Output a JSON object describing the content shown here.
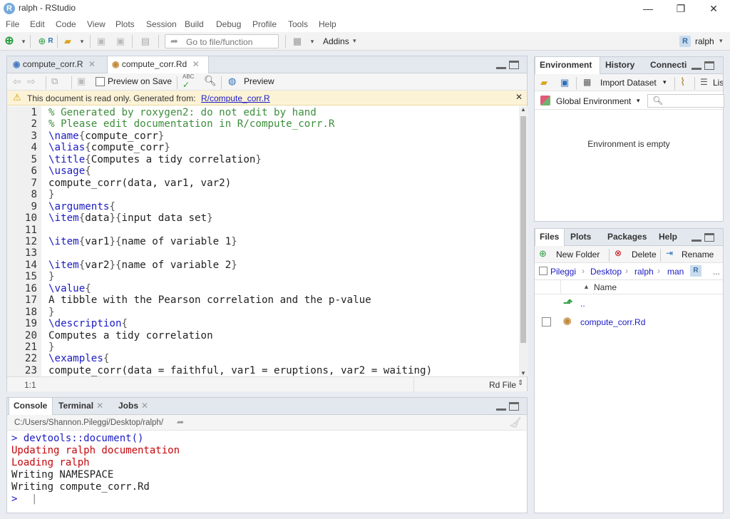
{
  "window": {
    "title": "ralph - RStudio",
    "app_icon": "R",
    "minimize": "—",
    "restore": "❐",
    "close": "✕"
  },
  "menu": [
    "File",
    "Edit",
    "Code",
    "View",
    "Plots",
    "Session",
    "Build",
    "Debug",
    "Profile",
    "Tools",
    "Help"
  ],
  "toolbar": {
    "goto_placeholder": "Go to file/function",
    "addins_label": "Addins",
    "project_label": "ralph"
  },
  "editor": {
    "tabs": [
      {
        "label": "compute_corr.R",
        "active": false
      },
      {
        "label": "compute_corr.Rd",
        "active": true
      }
    ],
    "preview_on_save_label": "Preview on Save",
    "preview_label": "Preview",
    "readonly_text": "This document is read only. Generated from:",
    "readonly_link": "R/compute_corr.R",
    "lines": [
      {
        "n": "1",
        "parts": [
          [
            "cm",
            "% Generated by roxygen2: do not edit by hand"
          ]
        ]
      },
      {
        "n": "2",
        "parts": [
          [
            "cm",
            "% Please edit documentation in R/compute_corr.R"
          ]
        ]
      },
      {
        "n": "3",
        "parts": [
          [
            "kw",
            "\\name"
          ],
          [
            "br",
            "{"
          ],
          [
            "tx",
            "compute_corr"
          ],
          [
            "br",
            "}"
          ]
        ]
      },
      {
        "n": "4",
        "parts": [
          [
            "kw",
            "\\alias"
          ],
          [
            "br",
            "{"
          ],
          [
            "tx",
            "compute_corr"
          ],
          [
            "br",
            "}"
          ]
        ]
      },
      {
        "n": "5",
        "parts": [
          [
            "kw",
            "\\title"
          ],
          [
            "br",
            "{"
          ],
          [
            "tx",
            "Computes a tidy correlation"
          ],
          [
            "br",
            "}"
          ]
        ]
      },
      {
        "n": "6",
        "parts": [
          [
            "kw",
            "\\usage"
          ],
          [
            "br",
            "{"
          ]
        ]
      },
      {
        "n": "7",
        "parts": [
          [
            "tx",
            "compute_corr(data, var1, var2)"
          ]
        ]
      },
      {
        "n": "8",
        "parts": [
          [
            "br",
            "}"
          ]
        ]
      },
      {
        "n": "9",
        "parts": [
          [
            "kw",
            "\\arguments"
          ],
          [
            "br",
            "{"
          ]
        ]
      },
      {
        "n": "10",
        "parts": [
          [
            "kw",
            "\\item"
          ],
          [
            "br",
            "{"
          ],
          [
            "tx",
            "data"
          ],
          [
            "br",
            "}{"
          ],
          [
            "tx",
            "input data set"
          ],
          [
            "br",
            "}"
          ]
        ]
      },
      {
        "n": "11",
        "parts": []
      },
      {
        "n": "12",
        "parts": [
          [
            "kw",
            "\\item"
          ],
          [
            "br",
            "{"
          ],
          [
            "tx",
            "var1"
          ],
          [
            "br",
            "}{"
          ],
          [
            "tx",
            "name of variable 1"
          ],
          [
            "br",
            "}"
          ]
        ]
      },
      {
        "n": "13",
        "parts": []
      },
      {
        "n": "14",
        "parts": [
          [
            "kw",
            "\\item"
          ],
          [
            "br",
            "{"
          ],
          [
            "tx",
            "var2"
          ],
          [
            "br",
            "}{"
          ],
          [
            "tx",
            "name of variable 2"
          ],
          [
            "br",
            "}"
          ]
        ]
      },
      {
        "n": "15",
        "parts": [
          [
            "br",
            "}"
          ]
        ]
      },
      {
        "n": "16",
        "parts": [
          [
            "kw",
            "\\value"
          ],
          [
            "br",
            "{"
          ]
        ]
      },
      {
        "n": "17",
        "parts": [
          [
            "tx",
            "A tibble with the Pearson correlation and the p-value"
          ]
        ]
      },
      {
        "n": "18",
        "parts": [
          [
            "br",
            "}"
          ]
        ]
      },
      {
        "n": "19",
        "parts": [
          [
            "kw",
            "\\description"
          ],
          [
            "br",
            "{"
          ]
        ]
      },
      {
        "n": "20",
        "parts": [
          [
            "tx",
            "Computes a tidy correlation"
          ]
        ]
      },
      {
        "n": "21",
        "parts": [
          [
            "br",
            "}"
          ]
        ]
      },
      {
        "n": "22",
        "parts": [
          [
            "kw",
            "\\examples"
          ],
          [
            "br",
            "{"
          ]
        ]
      },
      {
        "n": "23",
        "parts": [
          [
            "tx",
            "compute_corr(data = faithful, var1 = eruptions, var2 = waiting)"
          ]
        ]
      }
    ],
    "cursor_pos": "1:1",
    "file_type": "Rd File"
  },
  "console": {
    "tabs": [
      "Console",
      "Terminal",
      "Jobs"
    ],
    "path": "C:/Users/Shannon.Pileggi/Desktop/ralph/",
    "lines": [
      {
        "cls": "cmd",
        "text": "> devtools::document()"
      },
      {
        "cls": "err",
        "text": "Updating ralph documentation"
      },
      {
        "cls": "err",
        "text": "Loading ralph"
      },
      {
        "cls": "out",
        "text": "Writing NAMESPACE"
      },
      {
        "cls": "out",
        "text": "Writing compute_corr.Rd"
      },
      {
        "cls": "cmd",
        "text": "> "
      }
    ]
  },
  "environment": {
    "tabs": [
      "Environment",
      "History",
      "Connecti"
    ],
    "import_label": "Import Dataset",
    "list_label": "Lis",
    "scope_label": "Global Environment",
    "empty_message": "Environment is empty"
  },
  "files": {
    "tabs": [
      "Files",
      "Plots",
      "Packages",
      "Help"
    ],
    "new_folder_label": "New Folder",
    "delete_label": "Delete",
    "rename_label": "Rename",
    "breadcrumb": [
      "Pileggi",
      "Desktop",
      "ralph",
      "man"
    ],
    "breadcrumb_more": "...",
    "column_name": "Name",
    "parent_dir": "..",
    "rows": [
      "compute_corr.Rd"
    ]
  },
  "colors": {
    "keyword": "#1b1bc4",
    "comment": "#3c8d3c",
    "console_red": "#c5060b",
    "console_blue": "#1b1bc4",
    "link": "#1b1bc4"
  }
}
